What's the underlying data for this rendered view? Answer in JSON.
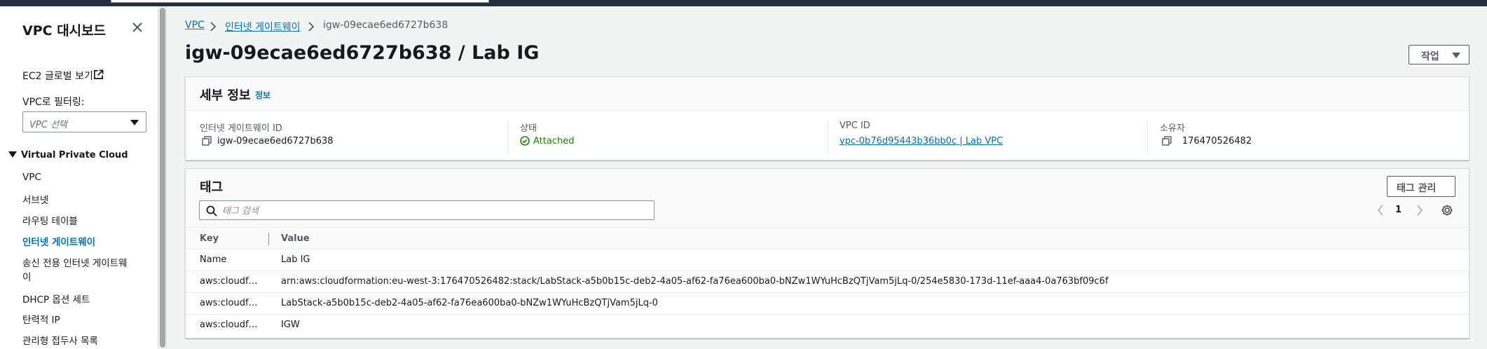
{
  "sidebar": {
    "title": "VPC 대시보드",
    "ec2_global_view": "EC2 글로벌 보기",
    "filter_label": "VPC로 필터링:",
    "filter_placeholder": "VPC 선택",
    "group_title": "Virtual Private Cloud",
    "items": [
      {
        "label": "VPC"
      },
      {
        "label": "서브넷"
      },
      {
        "label": "라우팅 테이블"
      },
      {
        "label": "인터넷 게이트웨이"
      },
      {
        "label": "송신 전용 인터넷 게이트웨"
      },
      {
        "label": "이"
      },
      {
        "label": "DHCP 옵션 세트"
      },
      {
        "label": "탄력적 IP"
      },
      {
        "label": "관리형 접두사 목록"
      }
    ]
  },
  "breadcrumb": {
    "items": [
      "VPC",
      "인터넷 게이트웨이"
    ],
    "current": "igw-09ecae6ed6727b638"
  },
  "header": {
    "title": "igw-09ecae6ed6727b638 / Lab IG",
    "action_label": "작업"
  },
  "details": {
    "title": "세부 정보",
    "info": "정보",
    "fields": [
      {
        "label": "인터넷 게이트웨이 ID",
        "value": "igw-09ecae6ed6727b638"
      },
      {
        "label": "상태",
        "value": "Attached"
      },
      {
        "label": "VPC ID",
        "value": "vpc-0b76d95443b36bb0c | Lab VPC"
      },
      {
        "label": "소유자",
        "value": "176470526482"
      }
    ]
  },
  "tags": {
    "title": "태그",
    "manage_label": "태그 관리",
    "search_placeholder": "태그 검색",
    "page": "1",
    "columns": [
      "Key",
      "Value"
    ],
    "rows": [
      {
        "key": "Name",
        "value": "Lab IG"
      },
      {
        "key": "aws:cloudf…",
        "value": "arn:aws:cloudformation:eu-west-3:176470526482:stack/LabStack-a5b0b15c-deb2-4a05-af62-fa76ea600ba0-bNZw1WYuHcBzQTjVam5jLq-0/254e5830-173d-11ef-aaa4-0a763bf09c6f"
      },
      {
        "key": "aws:cloudf…",
        "value": "LabStack-a5b0b15c-deb2-4a05-af62-fa76ea600ba0-bNZw1WYuHcBzQTjVam5jLq-0"
      },
      {
        "key": "aws:cloudf…",
        "value": "IGW"
      }
    ]
  },
  "colors": {
    "link": "#0073bb",
    "success": "#1d8102",
    "topbar": "#232f3e"
  }
}
